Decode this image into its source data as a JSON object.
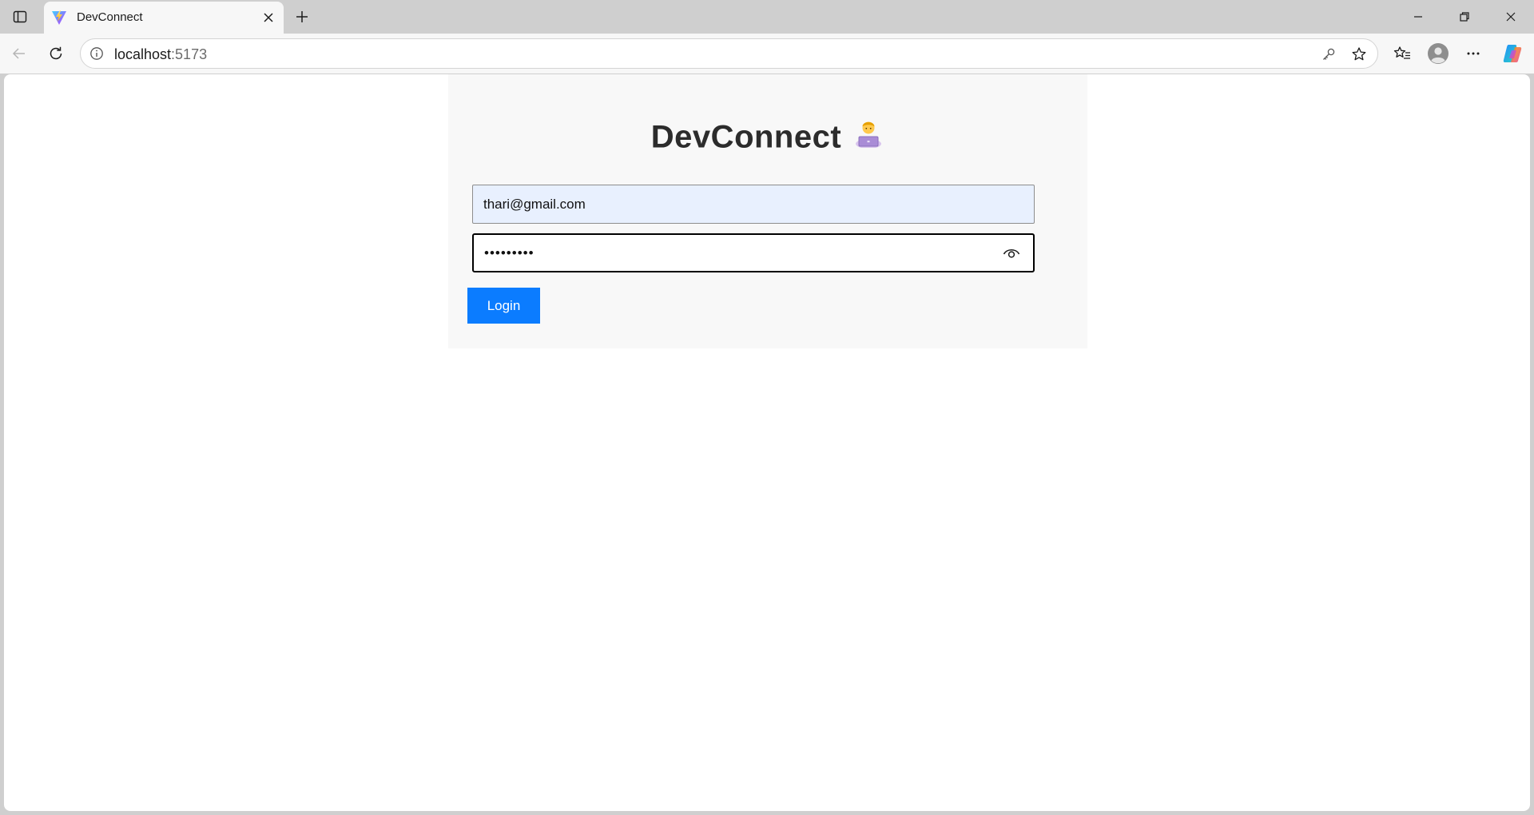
{
  "browser": {
    "tab": {
      "title": "DevConnect",
      "favicon": "vite-logo-icon"
    },
    "address_bar": {
      "host": "localhost",
      "port": ":5173"
    },
    "icons": {
      "tab_actions": "tab-actions-icon",
      "tab_close": "close-icon",
      "new_tab": "plus-icon",
      "back": "back-arrow-icon",
      "reload": "reload-icon",
      "site_info": "info-icon",
      "passwords": "key-icon",
      "add_favorite": "star-icon",
      "favorites": "favorites-icon",
      "profile": "profile-icon",
      "more": "more-icon",
      "copilot": "copilot-icon"
    }
  },
  "page": {
    "title": "DevConnect",
    "title_emoji": "technologist-emoji",
    "email_value": "thari@gmail.com",
    "password_value": "•••••••••",
    "password_toggle": "eye-icon",
    "login_label": "Login"
  },
  "colors": {
    "accent": "#0b7cff",
    "autofill_background": "#e8f0fe",
    "card_background": "#f8f8f8"
  }
}
